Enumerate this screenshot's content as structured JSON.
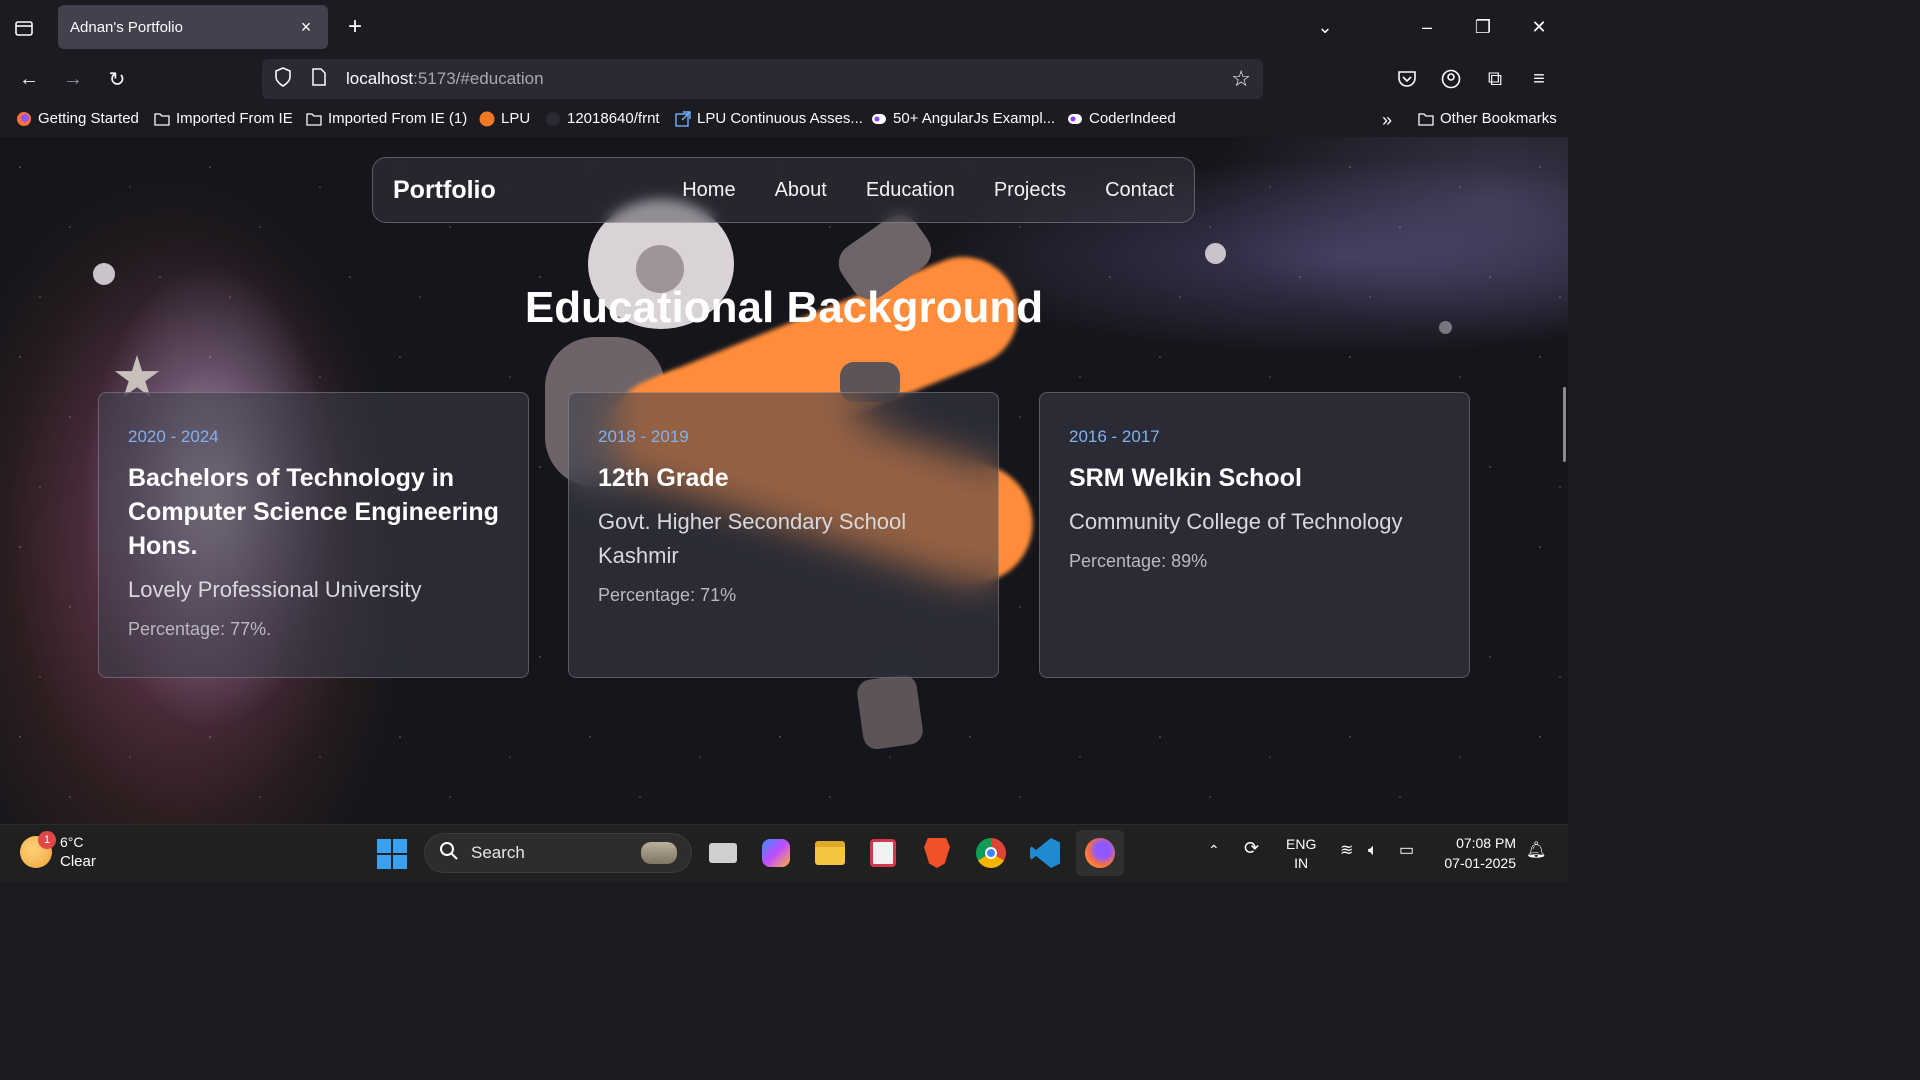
{
  "browser": {
    "tab_title": "Adnan's Portfolio",
    "url_host": "localhost",
    "url_path": ":5173/#education",
    "bookmarks": [
      {
        "label": "Getting Started",
        "icon": "firefox-icon"
      },
      {
        "label": "Imported From IE",
        "icon": "folder-icon"
      },
      {
        "label": "Imported From IE (1)",
        "icon": "folder-icon"
      },
      {
        "label": "LPU",
        "icon": "lpu-icon"
      },
      {
        "label": "12018640/frnt",
        "icon": "github-icon"
      },
      {
        "label": "LPU Continuous Asses...",
        "icon": "external-link-icon"
      },
      {
        "label": "50+ AngularJs Exampl...",
        "icon": "site-icon"
      },
      {
        "label": "CoderIndeed",
        "icon": "site-icon"
      }
    ],
    "other_bookmarks": "Other Bookmarks"
  },
  "site": {
    "brand": "Portfolio",
    "nav": [
      "Home",
      "About",
      "Education",
      "Projects",
      "Contact"
    ],
    "section_title": "Educational Background",
    "cards": [
      {
        "years": "2020 - 2024",
        "degree": "Bachelors of Technology in Computer Science Engineering Hons.",
        "institution": "Lovely Professional University",
        "percentage": "Percentage: 77%."
      },
      {
        "years": "2018 - 2019",
        "degree": "12th Grade",
        "institution": "Govt. Higher Secondary School Kashmir",
        "percentage": "Percentage: 71%"
      },
      {
        "years": "2016 - 2017",
        "degree": "SRM Welkin School",
        "institution": "Community College of Technology",
        "percentage": "Percentage: 89%"
      }
    ],
    "colors": {
      "accent_orange": "#ff8c3a",
      "years_blue": "#7fb2f0"
    }
  },
  "taskbar": {
    "weather_temp": "6°C",
    "weather_desc": "Clear",
    "weather_badge": "1",
    "search_placeholder": "Search",
    "lang_top": "ENG",
    "lang_bottom": "IN",
    "time": "07:08 PM",
    "date": "07-01-2025"
  }
}
